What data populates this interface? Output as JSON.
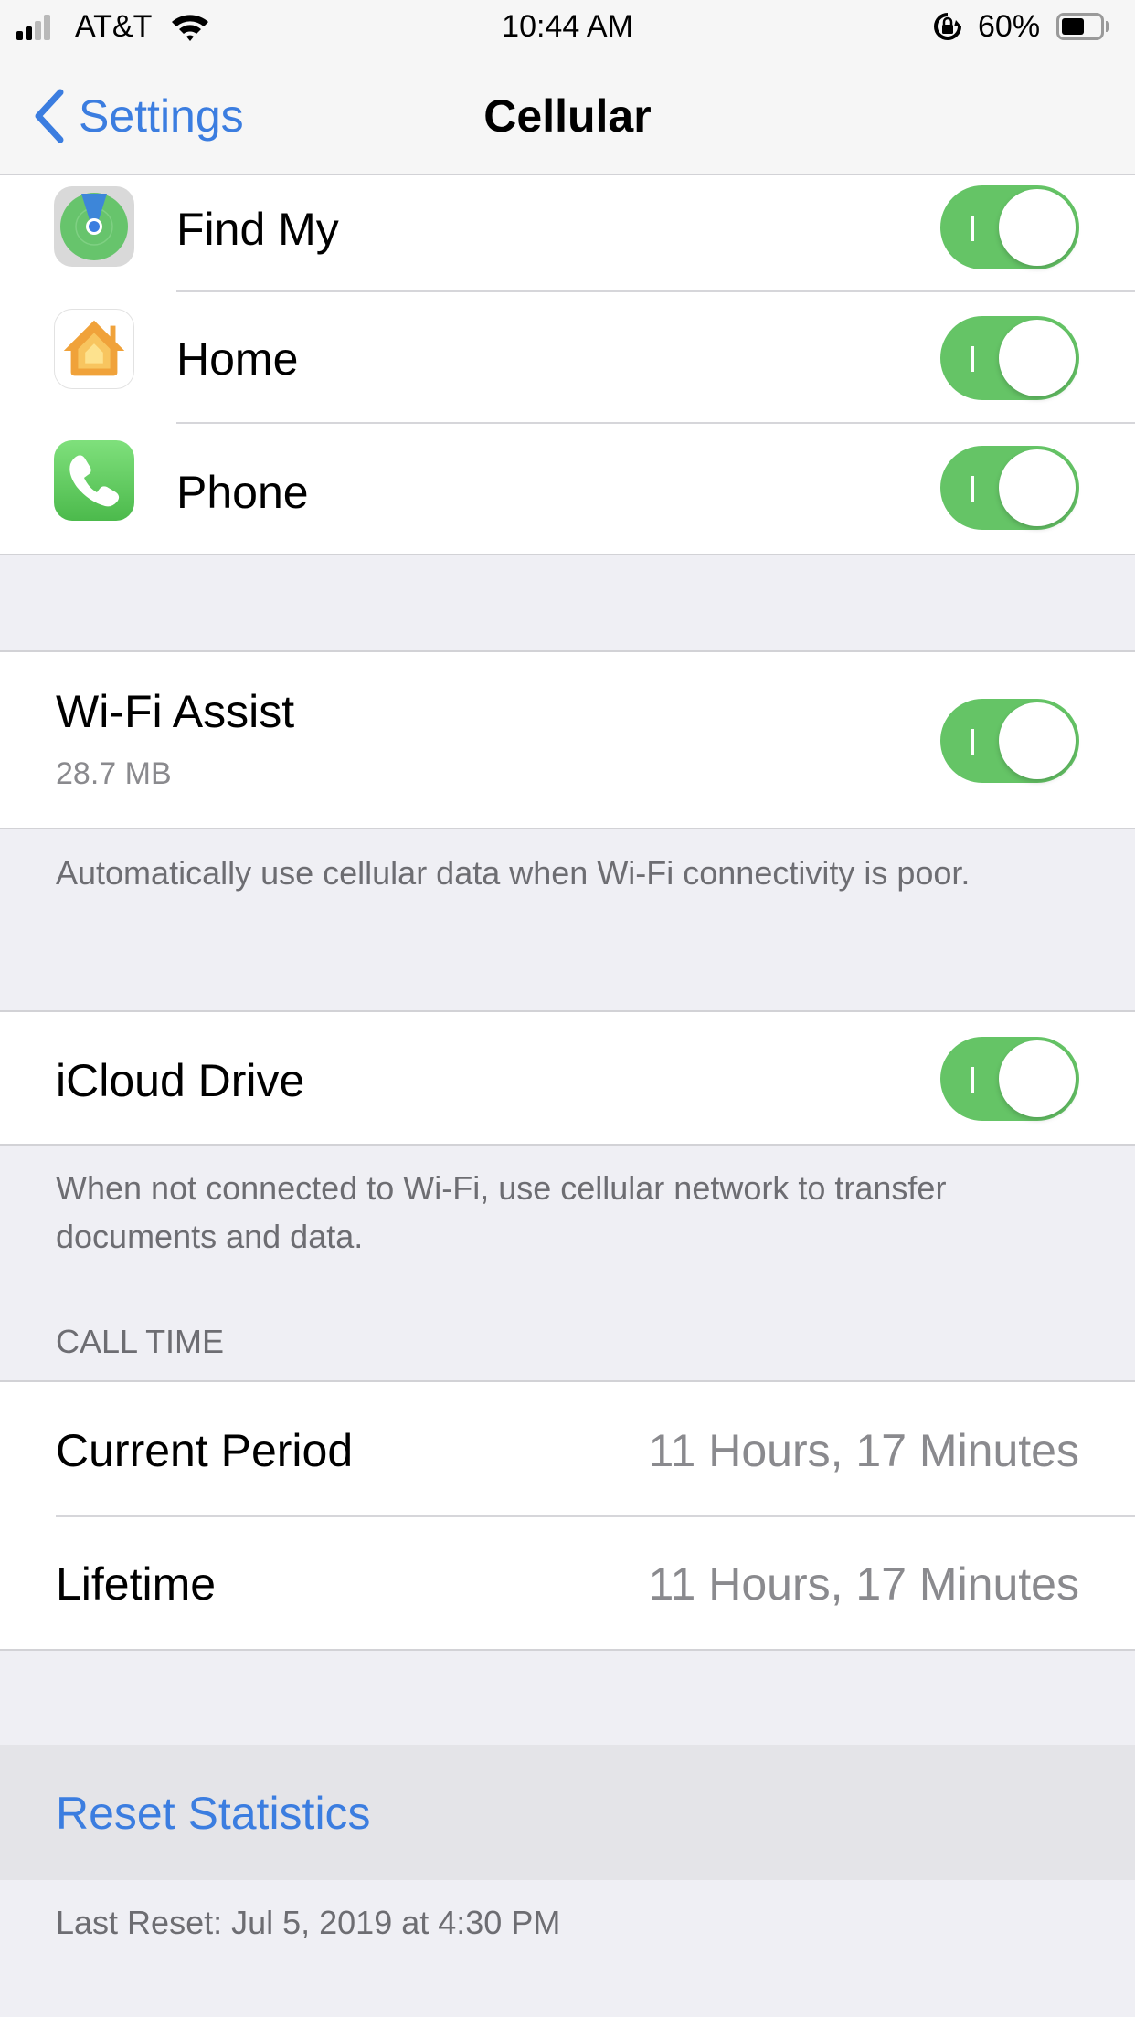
{
  "status_bar": {
    "carrier": "AT&T",
    "time": "10:44 AM",
    "battery_percent_label": "60%",
    "battery_level": 0.6,
    "signal_bars_active": 2,
    "signal_bars_total": 4,
    "icons": [
      "signal-icon",
      "wifi-icon",
      "orientation-lock-icon",
      "battery-icon"
    ]
  },
  "nav": {
    "back_label": "Settings",
    "title": "Cellular"
  },
  "app_rows": [
    {
      "label": "Find My",
      "icon": "find-my-icon",
      "enabled": true
    },
    {
      "label": "Home",
      "icon": "home-app-icon",
      "enabled": true
    },
    {
      "label": "Phone",
      "icon": "phone-app-icon",
      "enabled": true
    }
  ],
  "wifi_assist": {
    "label": "Wi-Fi Assist",
    "usage": "28.7 MB",
    "enabled": true,
    "footer": "Automatically use cellular data when Wi-Fi connectivity is poor."
  },
  "icloud_drive": {
    "label": "iCloud Drive",
    "enabled": true,
    "footer": "When not connected to Wi-Fi, use cellular network to transfer documents and data."
  },
  "call_time": {
    "header": "CALL TIME",
    "rows": [
      {
        "label": "Current Period",
        "value": "11 Hours, 17 Minutes"
      },
      {
        "label": "Lifetime",
        "value": "11 Hours, 17 Minutes"
      }
    ]
  },
  "reset": {
    "label": "Reset Statistics",
    "last_reset": "Last Reset: Jul 5, 2019 at 4:30 PM"
  },
  "colors": {
    "accent_blue": "#3b7de0",
    "toggle_on": "#65c466",
    "background": "#efeff4"
  }
}
